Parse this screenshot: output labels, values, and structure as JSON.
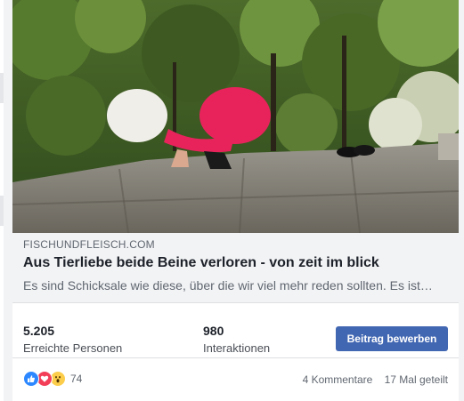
{
  "post": {
    "domain": "FISCHUNDFLEISCH.COM",
    "headline": "Aus Tierliebe beide Beine verloren - von zeit im blick",
    "description": "Es sind Schicksale wie diese, über die wir viel mehr reden sollten. Es ist…"
  },
  "insights": {
    "reach_value": "5.205",
    "reach_label": "Erreichte Personen",
    "engagement_value": "980",
    "engagement_label": "Interaktionen",
    "boost_label": "Beitrag bewerben"
  },
  "footer": {
    "reactions": [
      "like-icon",
      "love-icon",
      "wow-icon"
    ],
    "reaction_count": "74",
    "comments": "4 Kommentare",
    "shares": "17 Mal geteilt"
  },
  "colors": {
    "accent": "#4267b2",
    "like": "#2d88ff",
    "love": "#f33e58",
    "wow": "#fbcd4a"
  }
}
